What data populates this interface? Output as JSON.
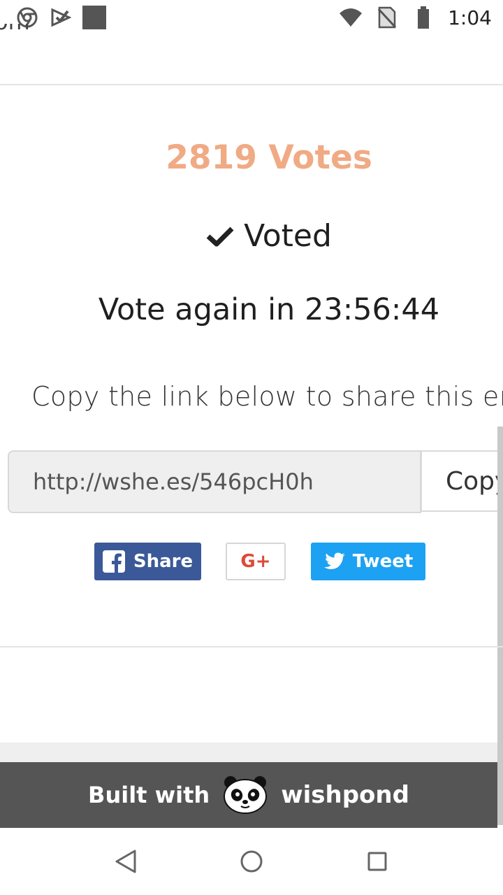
{
  "status_bar": {
    "time": "1:04",
    "left_icons": [
      "chrome-icon",
      "checkmark-app-icon",
      "square-app-icon"
    ],
    "right_icons": [
      "wifi-icon",
      "no-sim-icon",
      "battery-icon"
    ]
  },
  "page": {
    "cut_text": "om",
    "votes": "2819 Votes",
    "voted": "Voted",
    "vote_again": "Vote again in 23:56:44",
    "copy_instructions": "Copy the link below to share this entry",
    "share_link": "http://wshe.es/546pcH0h",
    "copy_button": "Copy"
  },
  "share_buttons": {
    "facebook": "Share",
    "google": "G+",
    "twitter": "Tweet"
  },
  "footer": {
    "built_with": "Built with",
    "brand": "wishpond"
  },
  "colors": {
    "votes_accent": "#f0aa84",
    "facebook": "#3b5998",
    "google": "#dc4a38",
    "twitter": "#1da1f2",
    "footer_bg": "#555555"
  }
}
